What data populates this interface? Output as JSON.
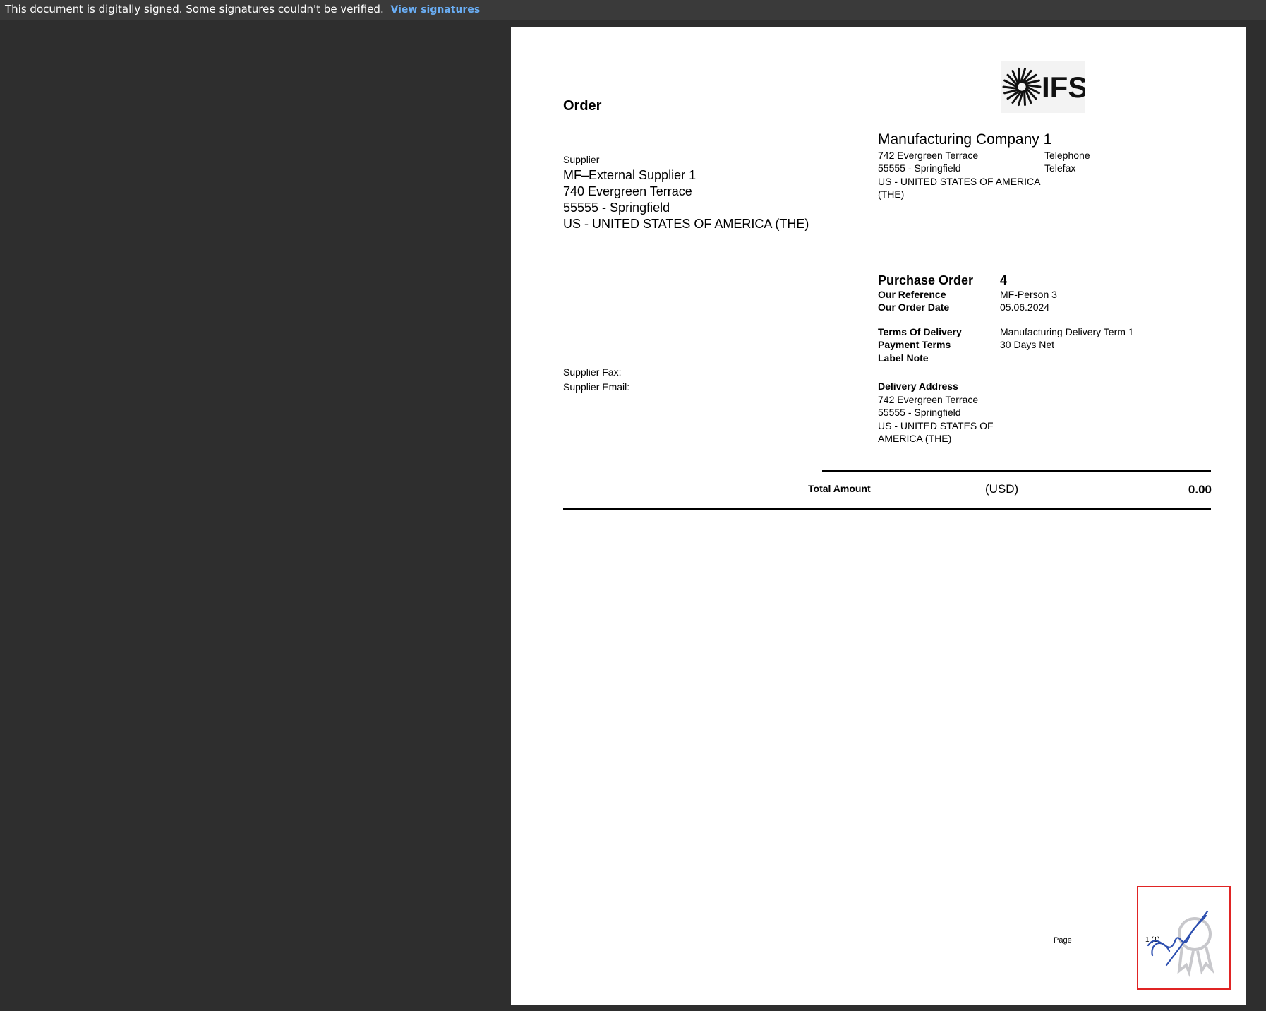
{
  "signature_bar": {
    "message": "This document is digitally signed. Some signatures couldn't be verified.",
    "link_label": "View signatures"
  },
  "document": {
    "logo_text": "IFS",
    "title": "Order",
    "company": {
      "name": "Manufacturing Company 1",
      "address_lines": [
        "742 Evergreen Terrace",
        "55555 - Springfield",
        "US - UNITED STATES OF AMERICA",
        "(THE)"
      ],
      "telephone_label": "Telephone",
      "telefax_label": "Telefax"
    },
    "supplier": {
      "label": "Supplier",
      "lines": [
        "MF–External Supplier 1",
        "740 Evergreen Terrace",
        "55555 - Springfield",
        "US - UNITED STATES OF AMERICA (THE)"
      ],
      "fax_label": "Supplier Fax:",
      "email_label": "Supplier Email:"
    },
    "order": {
      "title": "Purchase Order",
      "number": "4",
      "our_reference_label": "Our Reference",
      "our_reference": "MF-Person 3",
      "order_date_label": "Our Order Date",
      "order_date": "05.06.2024",
      "terms_of_delivery_label": "Terms Of Delivery",
      "terms_of_delivery": "Manufacturing Delivery Term 1",
      "payment_terms_label": "Payment Terms",
      "payment_terms": "30 Days Net",
      "label_note_label": "Label Note"
    },
    "delivery": {
      "title": "Delivery Address",
      "lines": [
        "742 Evergreen Terrace",
        "55555 - Springfield",
        "US - UNITED STATES OF",
        "AMERICA (THE)"
      ]
    },
    "totals": {
      "label": "Total Amount",
      "currency": "(USD)",
      "value": "0.00"
    },
    "footer": {
      "page_label": "Page",
      "page_number": "1 (1)"
    }
  }
}
